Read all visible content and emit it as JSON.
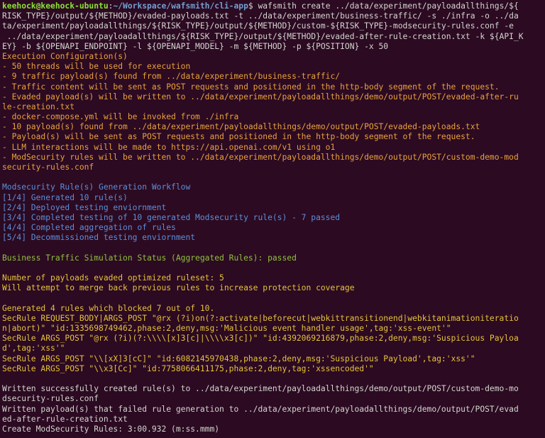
{
  "prompt": {
    "user_host": "keehock@keehock-ubuntu",
    "colon": ":",
    "path": "~/Workspace/wafsmith/cli-app",
    "dollar": "$"
  },
  "command_lines": [
    " wafsmith create ../data/experiment/payloadallthings/${",
    "RISK_TYPE}/output/${METHOD}/evaded-payloads.txt -t ../data/experiment/business-traffic/ -s ./infra -o ../da",
    "ta/experiment/payloadallthings/${RISK_TYPE}/output/${METHOD}/custom-${RISK_TYPE}-modsecurity-rules.conf -e",
    " ../data/experiment/payloadallthings/${RISK_TYPE}/output/${METHOD}/evaded-after-rule-creation.txt -k ${API_K",
    "EY} -b ${OPENAPI_ENDPOINT} -l ${OPENAPI_MODEL} -m ${METHOD} -p ${POSITION} -x 50"
  ],
  "execution_config": [
    "Execution Configuration(s)",
    "- 50 threads will be used for execution",
    "- 9 traffic payload(s) found from ../data/experiment/business-traffic/",
    "- Traffic content will be sent as POST requests and positioned in the http-body segment of the request.",
    "- Evaded payload(s) will be written to ../data/experiment/payloadallthings/demo/output/POST/evaded-after-ru",
    "le-creation.txt",
    "- docker-compose.yml will be invoked from ./infra",
    "- 10 payload(s) found from ../data/experiment/payloadallthings/demo/output/POST/evaded-payloads.txt",
    "- Payload(s) will be sent as POST requests and positioned in the http-body segment of the request.",
    "- LLM interactions will be made to https://api.openai.com/v1 using o1",
    "- ModSecurity rules will be written to ../data/experiment/payloadallthings/demo/output/POST/custom-demo-mod",
    "security-rules.conf"
  ],
  "workflow": [
    "Modsecurity Rule(s) Generation Workflow",
    "[1/4] Generated 10 rule(s)",
    "[2/4] Deployed testing enviornment",
    "[3/4] Completed testing of 10 generated Modsecurity rule(s) - 7 passed",
    "[4/4] Completed aggregation of rules",
    "[5/4] Decommissioned testing enviornment"
  ],
  "simulation_status": "Business Traffic Simulation Status (Aggregated Rules): passed",
  "evasion_summary": [
    "Number of payloads evaded optimized ruleset: 5",
    "Will attempt to merge back previous rules to increase protection coverage"
  ],
  "rules": [
    "Generated 4 rules which blocked 7 out of 10.",
    "SecRule REQUEST_BODY|ARGS_POST \"@rx (?i)on(?:activate|beforecut|webkittransitionend|webkitanimationiteratio",
    "n|abort)\" \"id:1335698749462,phase:2,deny,msg:'Malicious event handler usage',tag:'xss-event'\"",
    "SecRule ARGS_POST \"@rx (?i)(?:\\\\\\\\[x]3[c]|\\\\\\\\x3[c])\" \"id:4392069216879,phase:2,deny,msg:'Suspicious Payloa",
    "d',tag:'xss'\"",
    "SecRule ARGS_POST \"\\\\[xX]3[cC]\" \"id:6082145970438,phase:2,deny,msg:'Suspicious Payload',tag:'xss'\"",
    "SecRule ARGS_POST \"\\\\x3[Cc]\" \"id:7758066411175,phase:2,deny,tag:'xssencoded'\""
  ],
  "output_lines": [
    "Written successfully created rule(s) to ../data/experiment/payloadallthings/demo/output/POST/custom-demo-mo",
    "dsecurity-rules.conf",
    "Written payload(s) that failed rule generation to ../data/experiment/payloadallthings/demo/output/POST/evad",
    "ed-after-rule-creation.txt",
    "Create ModSecurity Rules: 3:00.932 (m:ss.mmm)"
  ],
  "colors": {
    "background": "#2c0a22",
    "prompt_user": "#8ae234",
    "prompt_path": "#729fcf",
    "config": "#e9a23b",
    "workflow": "#5d8fd8",
    "status": "#8fc23c",
    "rules": "#e5c33a",
    "text": "#d3d7cf"
  }
}
